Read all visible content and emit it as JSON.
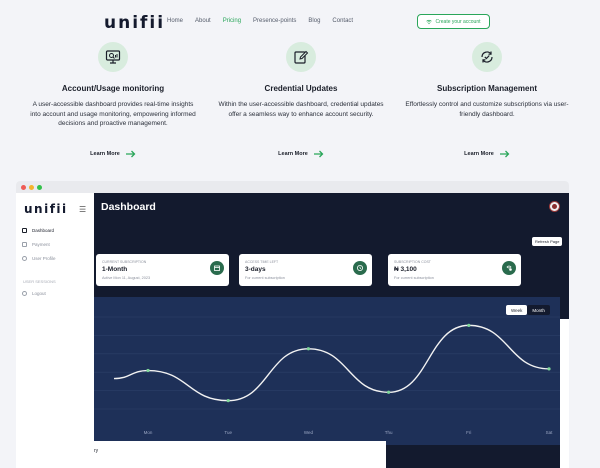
{
  "header": {
    "logo": "unifii",
    "nav": [
      {
        "label": "Home",
        "active": false
      },
      {
        "label": "About",
        "active": false
      },
      {
        "label": "Pricing",
        "active": true
      },
      {
        "label": "Presence-points",
        "active": false
      },
      {
        "label": "Blog",
        "active": false
      },
      {
        "label": "Contact",
        "active": false
      }
    ],
    "cta": {
      "label": "Create your account",
      "icon": "wifi-icon"
    }
  },
  "features": [
    {
      "icon": "monitor-search-icon",
      "title": "Account/Usage monitoring",
      "description": "A user-accessible dashboard provides real-time insights into account and usage monitoring, empowering informed decisions and proactive management.",
      "link": "Learn More"
    },
    {
      "icon": "edit-icon",
      "title": "Credential Updates",
      "description": "Within the user-accessible dashboard, credential updates offer a seamless way to enhance account security.",
      "link": "Learn More"
    },
    {
      "icon": "refresh-check-icon",
      "title": "Subscription Management",
      "description": "Effortlessly control and customize subscriptions via user-friendly dashboard.",
      "link": "Learn More"
    }
  ],
  "colors": {
    "accent": "#2aa65a",
    "dark": "#131a2e",
    "chart_bg": "#1e3058",
    "line": "#f2f2f2",
    "point": "#7fd89a"
  },
  "app": {
    "logo": "unifii",
    "sidebar": {
      "items": [
        {
          "label": "Dashboard",
          "icon": "dashboard-icon",
          "active": true
        },
        {
          "label": "Payment",
          "icon": "card-icon",
          "active": false
        },
        {
          "label": "User Profile",
          "icon": "user-icon",
          "active": false
        }
      ],
      "section": "USER SESSIONS",
      "logout": "Logout"
    },
    "title": "Dashboard",
    "refresh_label": "Refresh Page",
    "cards": [
      {
        "label": "CURRENT SUBSCRIPTION",
        "value": "1-Month",
        "sub": "Active Mon 11, August, 2023",
        "icon": "package-icon"
      },
      {
        "label": "ACCESS TIME LEFT",
        "value": "3-days",
        "sub": "For current subscription",
        "icon": "clock-icon"
      },
      {
        "label": "SUBSCRIPTION COST",
        "value": "₦ 3,100",
        "sub": "For current subscription",
        "icon": "money-icon"
      }
    ],
    "toggle": {
      "week": "Week",
      "month": "Month",
      "selected": "Week"
    },
    "bottom_text": "ry"
  },
  "chart_data": {
    "type": "line",
    "x": [
      "Mon",
      "Tue",
      "Wed",
      "Thu",
      "Fri",
      "Sat"
    ],
    "values": [
      0.46,
      0.1,
      0.72,
      0.2,
      1.0,
      0.48
    ],
    "ylim": [
      0,
      1.1
    ],
    "grid": true,
    "legend": "none",
    "title": "",
    "xlabel": "",
    "ylabel": ""
  }
}
